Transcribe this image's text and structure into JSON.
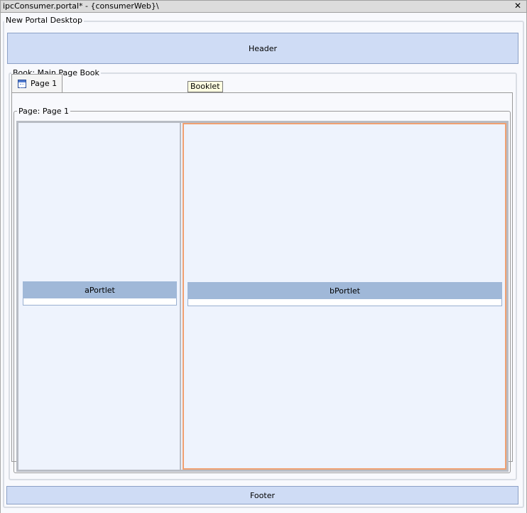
{
  "window": {
    "title": "ipcConsumer.portal* - {consumerWeb}\\",
    "close_label": "✕"
  },
  "desktop": {
    "legend": "New Portal Desktop"
  },
  "header": {
    "label": "Header"
  },
  "book": {
    "legend": "Book: Main Page Book"
  },
  "tab": {
    "label": "Page 1"
  },
  "tooltip": {
    "text": "Booklet"
  },
  "page": {
    "legend": "Page: Page 1"
  },
  "portlets": [
    {
      "title": "aPortlet"
    },
    {
      "title": "bPortlet"
    }
  ],
  "footer": {
    "label": "Footer"
  }
}
